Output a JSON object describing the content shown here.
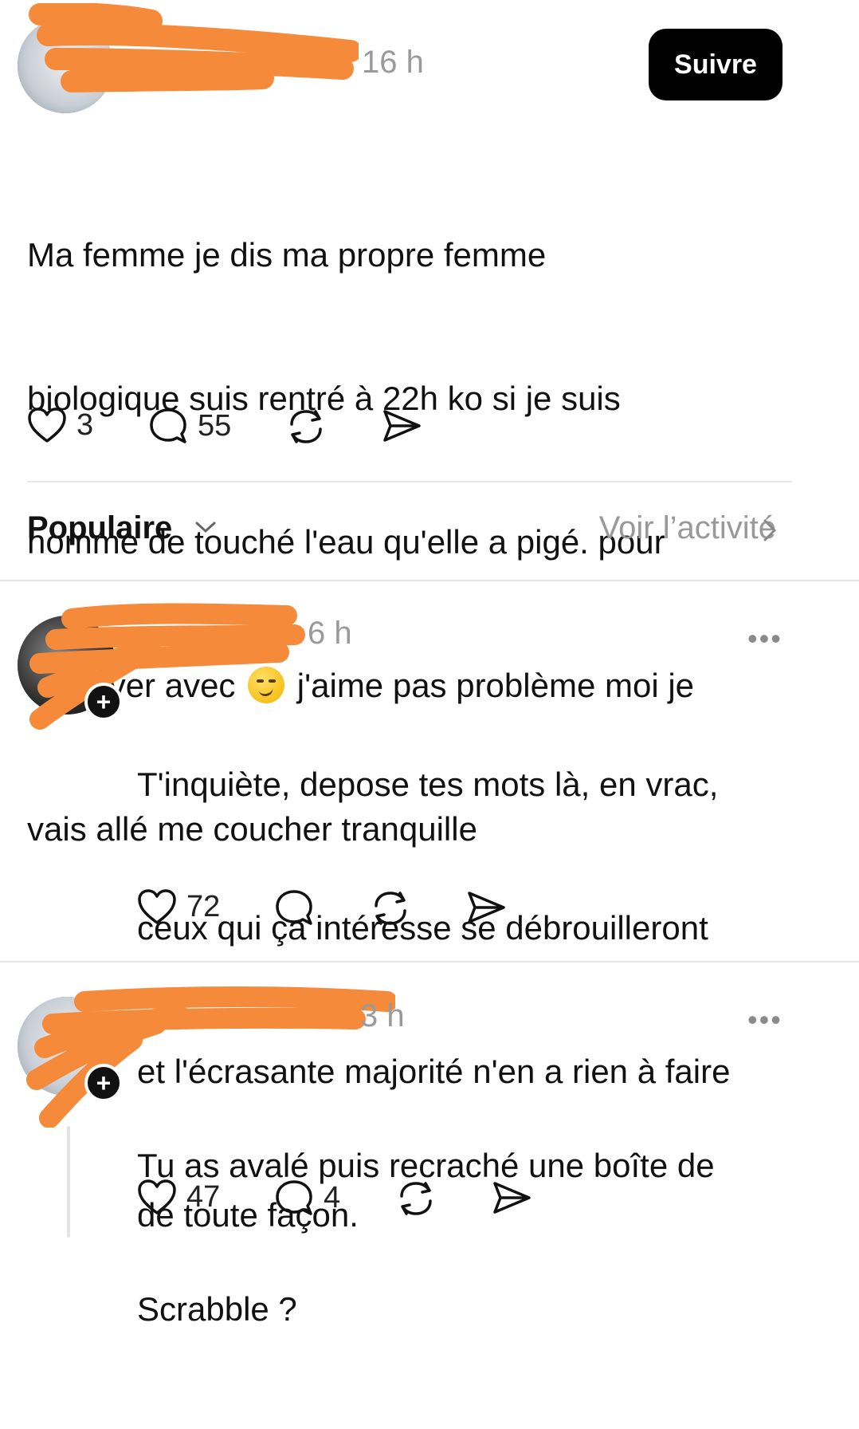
{
  "post": {
    "time": "16 h",
    "follow_label": "Suivre",
    "text_line1": "Ma femme je dis ma propre femme",
    "text_line2": "biologique suis rentré à 22h ko si je suis",
    "text_line3": "homme de touché l'eau qu'elle a pigé. pour",
    "text_line4_before": "me laver avec ",
    "text_line4_after": " j'aime pas problème moi je",
    "text_line5": "vais allé me coucher tranquille",
    "emoji": "smirking-face",
    "likes": "3",
    "replies": "55"
  },
  "sort": {
    "label": "Populaire",
    "activity_label": "Voir l’activité"
  },
  "comments": [
    {
      "time": "6 h",
      "more": "•••",
      "line1": "T'inquiète, depose tes mots là, en vrac,",
      "line2": "ceux qui ça intéresse se débrouilleront",
      "line3": "et l'écrasante majorité n'en a rien à faire",
      "line4": "de toute façon.",
      "likes": "72",
      "replies": ""
    },
    {
      "time": "3 h",
      "more": "•••",
      "line1": "Tu as avalé puis recraché une boîte de",
      "line2": "Scrabble ?",
      "likes": "47",
      "replies": "4"
    }
  ],
  "icons": {
    "like": "heart-icon",
    "reply": "speech-bubble-icon",
    "repost": "repost-icon",
    "share": "send-icon",
    "follow_badge": "plus-icon"
  },
  "colors": {
    "redaction": "#f58a3a",
    "button_bg": "#000000",
    "muted_text": "#999999"
  }
}
